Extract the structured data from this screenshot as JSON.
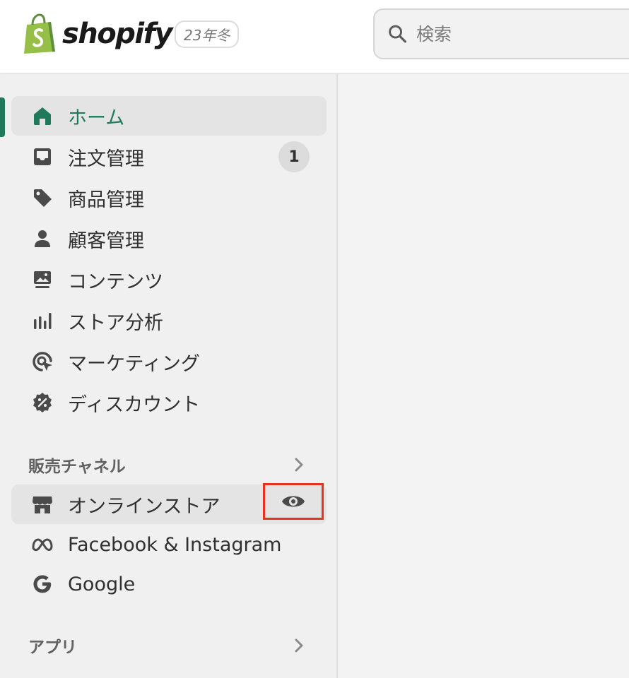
{
  "header": {
    "logo_text": "shopify",
    "version_badge": "23年冬",
    "search_placeholder": "検索"
  },
  "sidebar": {
    "nav": [
      {
        "label": "ホーム",
        "icon": "home-icon",
        "active": true
      },
      {
        "label": "注文管理",
        "icon": "inbox-icon",
        "badge": "1"
      },
      {
        "label": "商品管理",
        "icon": "tag-icon"
      },
      {
        "label": "顧客管理",
        "icon": "person-icon"
      },
      {
        "label": "コンテンツ",
        "icon": "image-content-icon"
      },
      {
        "label": "ストア分析",
        "icon": "bar-chart-icon"
      },
      {
        "label": "マーケティング",
        "icon": "target-cursor-icon"
      },
      {
        "label": "ディスカウント",
        "icon": "discount-icon"
      }
    ],
    "sales_channels": {
      "heading": "販売チャネル",
      "items": [
        {
          "label": "オンラインストア",
          "icon": "storefront-icon",
          "action_icon": "eye-icon"
        },
        {
          "label": "Facebook & Instagram",
          "icon": "meta-icon"
        },
        {
          "label": "Google",
          "icon": "google-icon"
        }
      ]
    },
    "apps": {
      "heading": "アプリ"
    }
  },
  "colors": {
    "accent_green": "#1e7a5b",
    "highlight_red": "#e8321f",
    "logo_green": "#95bf47"
  }
}
